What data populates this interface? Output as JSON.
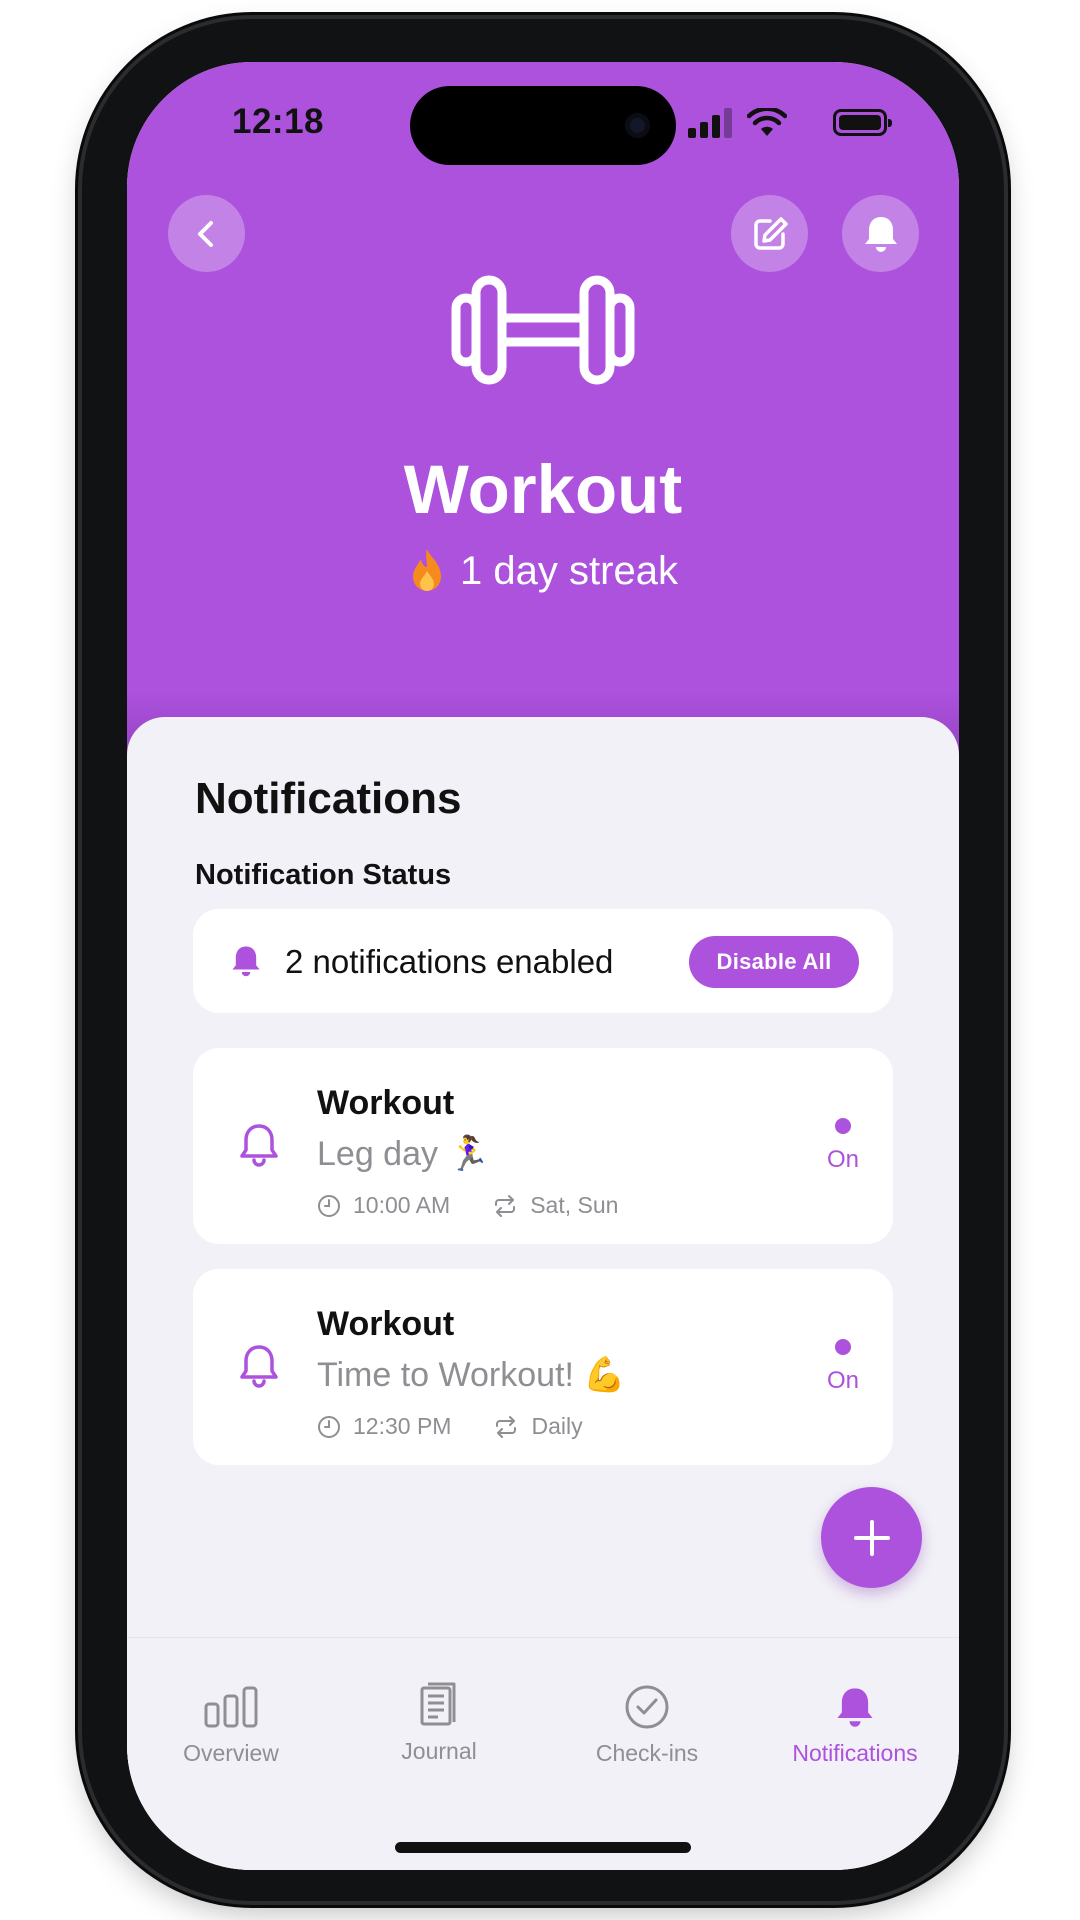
{
  "status_bar": {
    "time": "12:18"
  },
  "header": {
    "title": "Workout",
    "streak_text": "1 day streak",
    "icon": "dumbbell-icon",
    "background_color": "#ac52dd"
  },
  "sheet": {
    "title": "Notifications",
    "status_section_label": "Notification Status",
    "status_text": "2 notifications enabled",
    "disable_all_label": "Disable All"
  },
  "notifications": [
    {
      "name": "Workout",
      "message": "Leg day 🏃‍♀️",
      "time": "10:00 AM",
      "repeat": "Sat, Sun",
      "state": "On"
    },
    {
      "name": "Workout",
      "message": "Time to Workout! 💪",
      "time": "12:30 PM",
      "repeat": "Daily",
      "state": "On"
    }
  ],
  "tabs": [
    {
      "label": "Overview",
      "icon": "bar-chart-icon"
    },
    {
      "label": "Journal",
      "icon": "journal-icon"
    },
    {
      "label": "Check-ins",
      "icon": "check-circle-icon"
    },
    {
      "label": "Notifications",
      "icon": "bell-icon",
      "active": true
    }
  ],
  "colors": {
    "accent": "#ac52dd",
    "inactive": "#8e8e93",
    "background": "#f2f1f7"
  }
}
